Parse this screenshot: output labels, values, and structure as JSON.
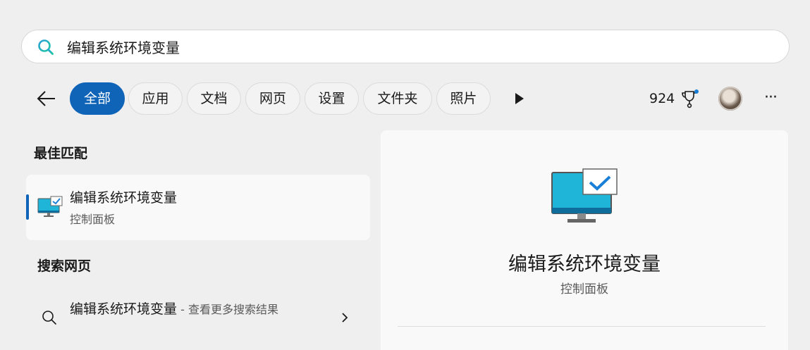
{
  "search": {
    "value": "编辑系统环境变量"
  },
  "filters": {
    "back_label": "back",
    "chips": [
      "全部",
      "应用",
      "文档",
      "网页",
      "设置",
      "文件夹",
      "照片"
    ],
    "points": "924"
  },
  "best_match": {
    "heading": "最佳匹配",
    "title": "编辑系统环境变量",
    "subtitle": "控制面板"
  },
  "web_search": {
    "heading": "搜索网页",
    "query": "编辑系统环境变量",
    "suffix": " - 查看更多搜索结果"
  },
  "detail": {
    "title": "编辑系统环境变量",
    "subtitle": "控制面板"
  },
  "colors": {
    "accent": "#0f64b8",
    "icon_teal": "#1fb5d8"
  }
}
